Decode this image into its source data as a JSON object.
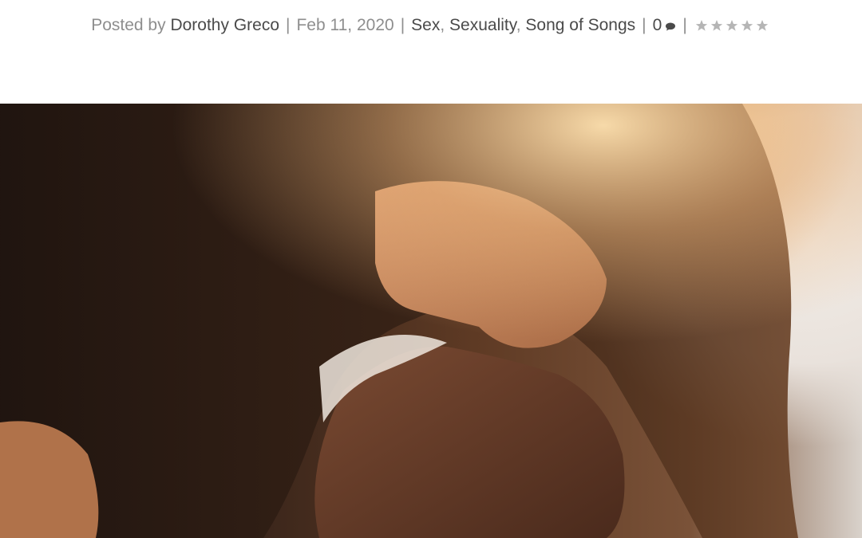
{
  "post_meta": {
    "posted_by_label": "Posted by",
    "author": "Dorothy Greco",
    "separator": "|",
    "date": "Feb 11, 2020",
    "categories": [
      {
        "label": "Sex"
      },
      {
        "label": "Sexuality"
      },
      {
        "label": "Song of Songs"
      }
    ],
    "category_separator": ",",
    "comment_count": "0",
    "comment_icon": "speech-bubble-icon",
    "rating": {
      "stars_total": 5,
      "stars_filled": 0,
      "icon": "star-icon",
      "empty_color": "#b5b5b5"
    }
  },
  "featured_image": {
    "description_icon": "couple-photo"
  },
  "colors": {
    "meta_text": "#8e8e8e",
    "link_text": "#4a4a4a",
    "background": "#ffffff"
  }
}
